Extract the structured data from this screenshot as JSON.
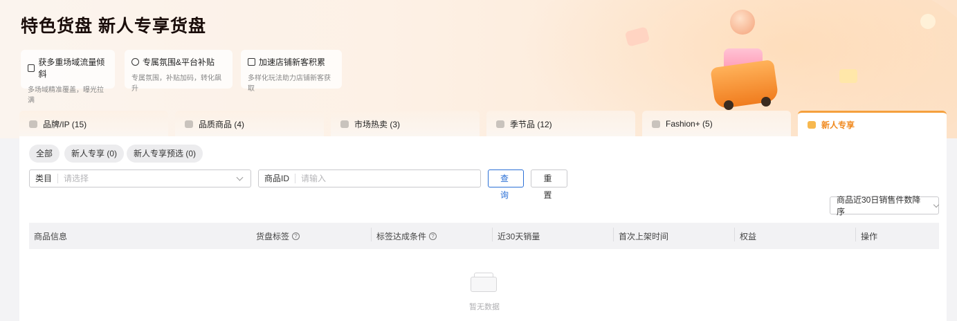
{
  "hero": {
    "title": "特色货盘 新人专享货盘",
    "features": [
      {
        "title": "获多重场域流量倾斜",
        "desc": "多场域精准覆盖，曝光拉满",
        "icon": "chart-icon"
      },
      {
        "title": "专属氛围&平台补贴",
        "desc": "专属氛围，补贴加码，转化飙升",
        "icon": "check-circle-icon"
      },
      {
        "title": "加速店铺新客积累",
        "desc": "多样化玩法助力店铺新客获取",
        "icon": "bar-chart-icon"
      }
    ]
  },
  "tabs": [
    {
      "label": "品牌/IP (15)",
      "icon": "brand-icon"
    },
    {
      "label": "品质商品 (4)",
      "icon": "heart-icon"
    },
    {
      "label": "市场热卖 (3)",
      "icon": "hot-icon"
    },
    {
      "label": "季节品 (12)",
      "icon": "season-icon"
    },
    {
      "label": "Fashion+ (5)",
      "icon": "fashion-icon"
    },
    {
      "label": "新人专享",
      "icon": "gift-icon",
      "active": true
    }
  ],
  "filters": {
    "chips": [
      "全部",
      "新人专享 (0)",
      "新人专享预选 (0)"
    ],
    "category": {
      "label": "类目",
      "placeholder": "请选择"
    },
    "product_id": {
      "label": "商品ID",
      "placeholder": "请输入"
    },
    "query_button": "查询",
    "reset_button": "重置",
    "sort_select": "商品近30日销售件数降序"
  },
  "table": {
    "columns": [
      "商品信息",
      "货盘标签",
      "标签达成条件",
      "近30天销量",
      "首次上架时间",
      "权益",
      "操作"
    ],
    "empty_text": "暂无数据"
  },
  "colors": {
    "accent": "#f5a03d",
    "primary_button": "#2a6fd6"
  }
}
